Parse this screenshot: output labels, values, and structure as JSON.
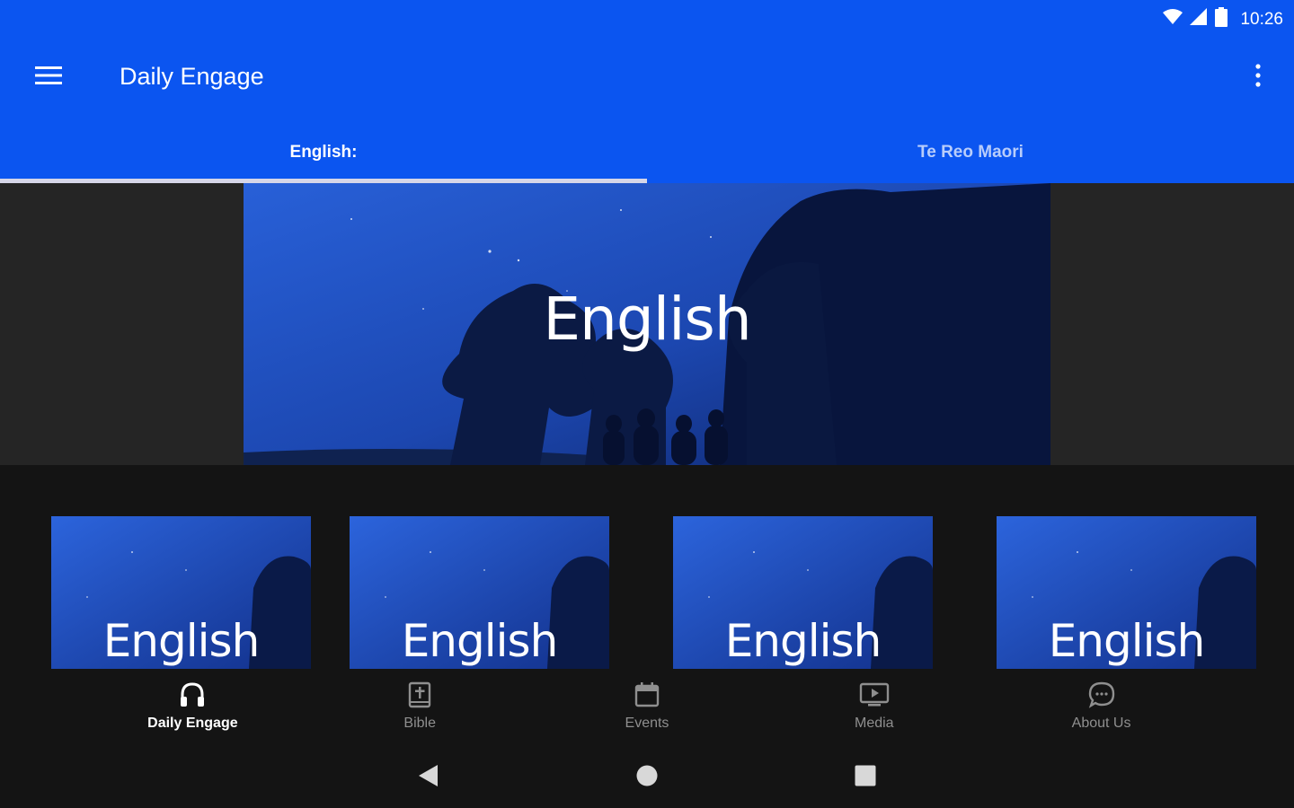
{
  "status_bar": {
    "time": "10:26",
    "icons": [
      "wifi-icon",
      "cellular-signal-icon",
      "battery-icon"
    ]
  },
  "app_bar": {
    "title": "Daily Engage",
    "menu_icon": "hamburger-menu-icon",
    "overflow_icon": "more-vertical-icon"
  },
  "tabs": [
    {
      "label": "English:",
      "active": true
    },
    {
      "label": "Te Reo Maori",
      "active": false
    }
  ],
  "hero": {
    "title": "English"
  },
  "cards": [
    {
      "title": "English"
    },
    {
      "title": "English"
    },
    {
      "title": "English"
    },
    {
      "title": "English"
    }
  ],
  "bottom_nav": [
    {
      "label": "Daily Engage",
      "icon": "headphones-icon",
      "active": true
    },
    {
      "label": "Bible",
      "icon": "bible-icon",
      "active": false
    },
    {
      "label": "Events",
      "icon": "calendar-icon",
      "active": false
    },
    {
      "label": "Media",
      "icon": "tv-play-icon",
      "active": false
    },
    {
      "label": "About Us",
      "icon": "chat-bubble-icon",
      "active": false
    }
  ],
  "system_nav": [
    "back-icon",
    "home-icon",
    "recents-icon"
  ],
  "colors": {
    "primary": "#0b55f0",
    "background": "#141414",
    "hero_side": "#252525",
    "tab_indicator": "#d6d6e8",
    "night_sky": "#1e4fc0"
  }
}
